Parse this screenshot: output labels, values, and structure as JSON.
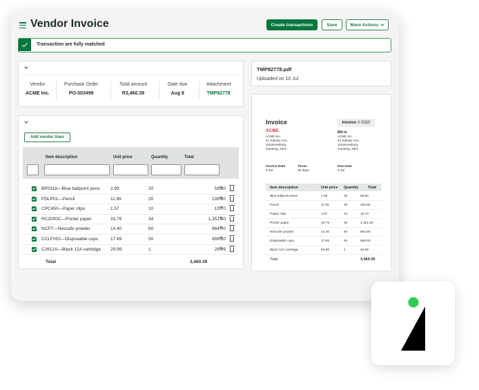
{
  "header": {
    "title": "Vendor Invoice",
    "create_label": "Create transactions",
    "save_label": "Save",
    "more_label": "More Actions"
  },
  "banner": {
    "message": "Transaction are fully matched"
  },
  "summary": {
    "vendor_label": "Vendor",
    "vendor": "ACME Inc.",
    "po_label": "Purchase Order",
    "po": "PO-003499",
    "total_label": "Total amount",
    "total": "R3,460.39",
    "due_label": "Date due",
    "due": "Aug 8",
    "attachment_label": "Attachment",
    "attachment": "TMP82778"
  },
  "attachment_card": {
    "filename": "TMP82778.pdf",
    "uploaded": "Uploaded on 10 Jul"
  },
  "lines": {
    "add_label": "Add vendor lines",
    "headers": {
      "desc": "Item description",
      "price": "Unit price",
      "qty": "Quantity",
      "total": "Total"
    },
    "rows": [
      {
        "desc": "BP0316—Blue ballpoint pens",
        "price": "2.99",
        "qty": "20",
        "total": "59.80"
      },
      {
        "desc": "PDLP01—Pencil",
        "price": "11.99",
        "qty": "20",
        "total": "239.80"
      },
      {
        "desc": "CPC450—Paper clips",
        "price": "1.57",
        "qty": "10",
        "total": "15.70"
      },
      {
        "desc": "RC2000C—Printer paper",
        "price": "33.79",
        "qty": "34",
        "total": "1,351.60"
      },
      {
        "desc": "NCP7—Nescafe powder",
        "price": "14.40",
        "qty": "60",
        "total": "864.00"
      },
      {
        "desc": "CCLF002—Disposable cups",
        "price": "17.99",
        "qty": "50",
        "total": "899.50"
      },
      {
        "desc": "C2612A—Black 12A cartridge",
        "price": "29.99",
        "qty": "1",
        "total": "29.99"
      }
    ],
    "total_label": "Total",
    "total_value": "3,460.39"
  },
  "preview": {
    "title": "Invoice",
    "invoice_no_label": "Invoice",
    "invoice_no": "# 0310",
    "logo_text": "ACME",
    "from_address": "ACME Inc.\n44 Stanley Ave,\nJohannesburg,\nGauteng, 2001",
    "bill_to_label": "Bill to",
    "bill_to_address": "ACME Inc.\n44 Stanley Ave,\nJohannesburg,\nGauteng, 2001",
    "invoice_date_label": "Invoice Date",
    "invoice_date": "8 Jul",
    "terms_label": "Terms",
    "terms": "30 days",
    "due_date_label": "Due Date",
    "due_date": "8 Jul",
    "headers": {
      "desc": "Item description",
      "price": "Unit price",
      "qty": "Quantity",
      "total": "Total"
    },
    "rows": [
      {
        "desc": "Blue ballpoint pens",
        "price": "2.99",
        "qty": "20",
        "total": "59.80"
      },
      {
        "desc": "Pencil",
        "price": "11.99",
        "qty": "20",
        "total": "239.80"
      },
      {
        "desc": "Paper clips",
        "price": "1.57",
        "qty": "10",
        "total": "15.70"
      },
      {
        "desc": "Printer paper",
        "price": "33.79",
        "qty": "34",
        "total": "1,351.60"
      },
      {
        "desc": "Nescafe powder",
        "price": "14.40",
        "qty": "60",
        "total": "864.00"
      },
      {
        "desc": "Disposable cups",
        "price": "17.99",
        "qty": "50",
        "total": "899.50"
      },
      {
        "desc": "Black 12A cartridge",
        "price": "29.99",
        "qty": "1",
        "total": "29.99"
      }
    ],
    "total_label": "Total",
    "total_value": "3,460.39"
  },
  "colors": {
    "brand_green": "#00763c",
    "logo_red": "#d8202a",
    "logo_dot": "#2ecc52"
  }
}
